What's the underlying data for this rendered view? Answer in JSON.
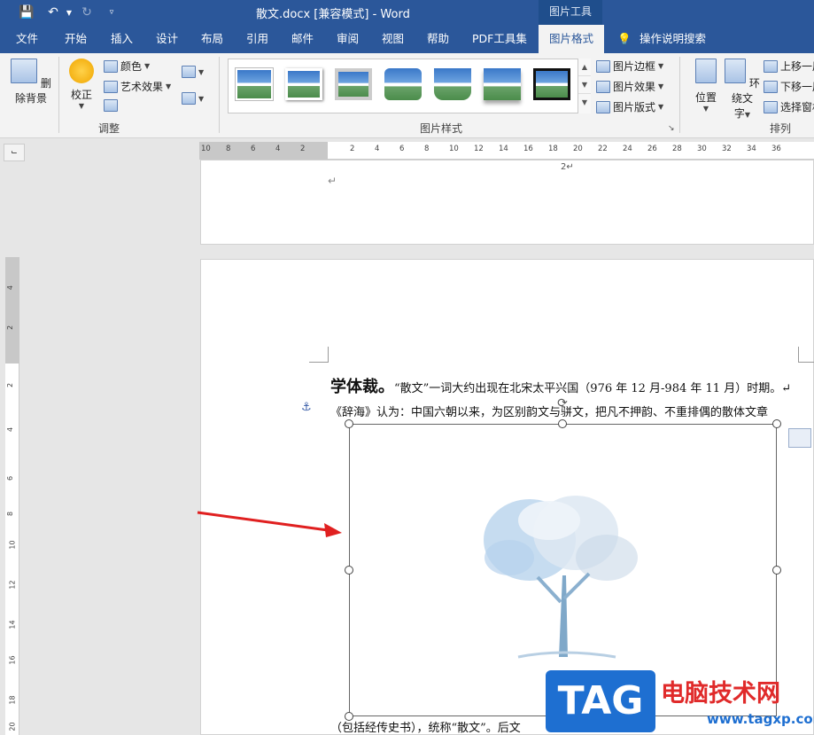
{
  "titlebar": {
    "document_title": "散文.docx [兼容模式]  -  Word",
    "context_tab_group": "图片工具"
  },
  "tabs": [
    "文件",
    "开始",
    "插入",
    "设计",
    "布局",
    "引用",
    "邮件",
    "审阅",
    "视图",
    "帮助",
    "PDF工具集",
    "图片格式",
    "操作说明搜索"
  ],
  "ribbon": {
    "remove_background": "删除背景",
    "corrections": "校正",
    "color": "颜色",
    "artistic_effects": "艺术效果",
    "adjust_group": "调整",
    "picture_styles_group": "图片样式",
    "picture_border": "图片边框",
    "picture_effects": "图片效果",
    "picture_layout": "图片版式",
    "position": "位置",
    "wrap_text_line1": "环绕文",
    "wrap_text_line2": "字",
    "bring_forward": "上移一层",
    "send_backward": "下移一层",
    "selection_pane": "选择窗格",
    "arrange_group": "排列"
  },
  "hruler_ticks": [
    "10",
    "8",
    "6",
    "4",
    "2",
    "2",
    "4",
    "6",
    "8",
    "10",
    "12",
    "14",
    "16",
    "18",
    "20",
    "22",
    "24",
    "26",
    "28",
    "30",
    "32",
    "34",
    "36"
  ],
  "vruler_ticks": [
    "4",
    "2",
    "2",
    "4",
    "6",
    "8",
    "10",
    "12",
    "14",
    "16",
    "18",
    "20"
  ],
  "page1": {
    "page_number": "2↵"
  },
  "document": {
    "line1_bold": "学体裁。",
    "line1_text": "“散文”一词大约出现在北宋太平兴国（976 年 12 月-984 年 11 月）时期。↵",
    "line2_text": "《辞海》认为：中国六朝以来，为区别韵文与骈文，把凡不押韵、不重排偶的散体文章",
    "line3_text": "（包括经传史书），统称“散文”。后文"
  },
  "watermark": {
    "badge": "TAG",
    "title": "电脑技术网",
    "url": "www.tagxp.com"
  }
}
